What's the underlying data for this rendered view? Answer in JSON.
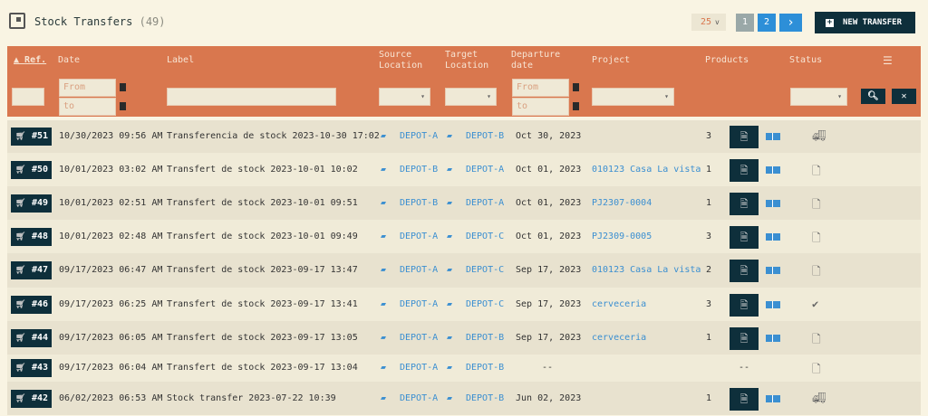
{
  "page": {
    "title": "Stock Transfers",
    "count": "(49)",
    "per_page": "25",
    "pages": [
      "1",
      "2"
    ],
    "next": "›",
    "new_button": "NEW TRANSFER"
  },
  "columns": {
    "ref": "Ref.",
    "date": "Date",
    "label": "Label",
    "source": [
      "Source",
      "Location"
    ],
    "target": [
      "Target",
      "Location"
    ],
    "departure": [
      "Departure",
      "date"
    ],
    "project": "Project",
    "products": "Products",
    "status": "Status"
  },
  "filters": {
    "from": "From",
    "to": "to"
  },
  "colors": {
    "header": "#d9774e",
    "dark": "#0e2f3b",
    "link": "#3b8fd1",
    "bg": "#f9f4e3"
  },
  "rows": [
    {
      "ref": "#51",
      "date": "10/30/2023 09:56 AM",
      "label": "Transferencia de stock 2023-10-30 17:02",
      "source": "DEPOT-A",
      "target": "DEPOT-B",
      "departure": "Oct 30, 2023",
      "project": "",
      "products": "3",
      "status": "truck-icon"
    },
    {
      "ref": "#50",
      "date": "10/01/2023 03:02 AM",
      "label": "Transfert de stock 2023-10-01 10:02",
      "source": "DEPOT-B",
      "target": "DEPOT-A",
      "departure": "Oct 01, 2023",
      "project": "010123 Casa La vista",
      "products": "1",
      "status": "draft-icon"
    },
    {
      "ref": "#49",
      "date": "10/01/2023 02:51 AM",
      "label": "Transfert de stock 2023-10-01 09:51",
      "source": "DEPOT-B",
      "target": "DEPOT-A",
      "departure": "Oct 01, 2023",
      "project": "PJ2307-0004",
      "products": "1",
      "status": "draft-icon"
    },
    {
      "ref": "#48",
      "date": "10/01/2023 02:48 AM",
      "label": "Transfert de stock 2023-10-01 09:49",
      "source": "DEPOT-A",
      "target": "DEPOT-C",
      "departure": "Oct 01, 2023",
      "project": "PJ2309-0005",
      "products": "3",
      "status": "draft-icon"
    },
    {
      "ref": "#47",
      "date": "09/17/2023 06:47 AM",
      "label": "Transfert de stock 2023-09-17 13:47",
      "source": "DEPOT-A",
      "target": "DEPOT-C",
      "departure": "Sep 17, 2023",
      "project": "010123 Casa La vista",
      "products": "2",
      "status": "draft-icon"
    },
    {
      "ref": "#46",
      "date": "09/17/2023 06:25 AM",
      "label": "Transfert de stock 2023-09-17 13:41",
      "source": "DEPOT-A",
      "target": "DEPOT-C",
      "departure": "Sep 17, 2023",
      "project": "cerveceria",
      "products": "3",
      "status": "check-icon"
    },
    {
      "ref": "#44",
      "date": "09/17/2023 06:05 AM",
      "label": "Transfert de stock 2023-09-17 13:05",
      "source": "DEPOT-A",
      "target": "DEPOT-B",
      "departure": "Sep 17, 2023",
      "project": "cerveceria",
      "products": "1",
      "status": "draft-icon"
    },
    {
      "ref": "#43",
      "date": "09/17/2023 06:04 AM",
      "label": "Transfert de stock 2023-09-17 13:04",
      "source": "DEPOT-A",
      "target": "DEPOT-B",
      "departure": "--",
      "project": "",
      "products": "--",
      "status": "draft-icon"
    },
    {
      "ref": "#42",
      "date": "06/02/2023 06:53 AM",
      "label": "Stock transfer 2023-07-22 10:39",
      "source": "DEPOT-A",
      "target": "DEPOT-B",
      "departure": "Jun 02, 2023",
      "project": "",
      "products": "1",
      "status": "truck-icon"
    }
  ]
}
